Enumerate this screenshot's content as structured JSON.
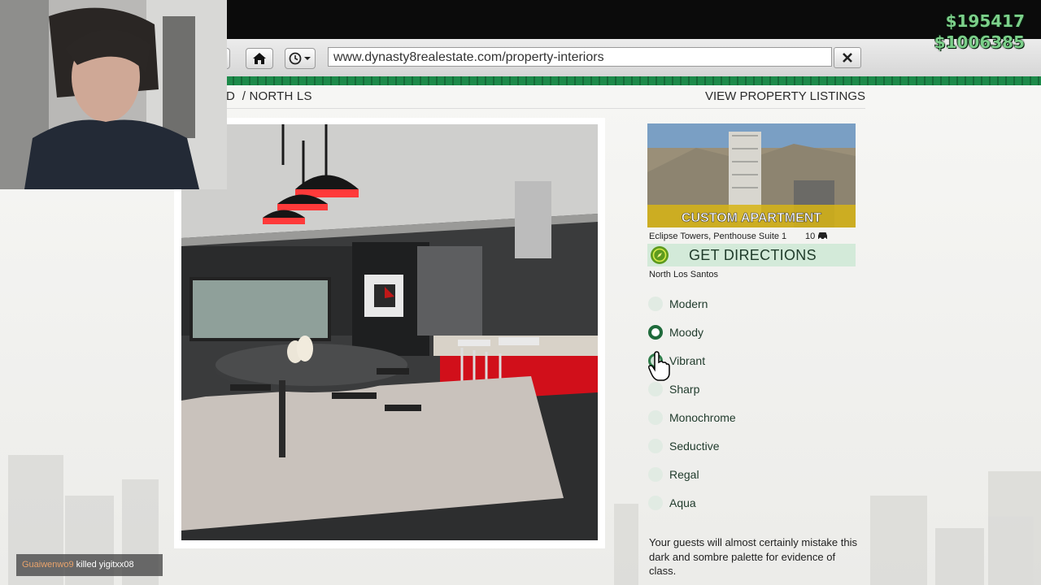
{
  "browser": {
    "url": "www.dynasty8realestate.com/property-interiors",
    "home_icon": "home-icon",
    "history_icon": "history-clock-icon",
    "close_icon": "close-icon"
  },
  "header": {
    "breadcrumb": "D  / NORTH LS",
    "view_listings": "VIEW PROPERTY LISTINGS"
  },
  "property": {
    "banner": "CUSTOM APARTMENT",
    "name": "Eclipse Towers, Penthouse Suite 1",
    "garage_count": "10",
    "garage_icon": "car-icon",
    "directions_label": "GET DIRECTIONS",
    "directions_icon": "compass-icon",
    "area": "North Los Santos"
  },
  "styles": {
    "options": [
      {
        "label": "Modern",
        "selected": false
      },
      {
        "label": "Moody",
        "selected": true
      },
      {
        "label": "Vibrant",
        "selected": false
      },
      {
        "label": "Sharp",
        "selected": false
      },
      {
        "label": "Monochrome",
        "selected": false
      },
      {
        "label": "Seductive",
        "selected": false
      },
      {
        "label": "Regal",
        "selected": false
      },
      {
        "label": "Aqua",
        "selected": false
      }
    ],
    "description": "Your guests will almost certainly mistake this dark and sombre palette for evidence of class."
  },
  "hud": {
    "cash": "$195417",
    "bank": "$1006385"
  },
  "kill_feed": {
    "killer": "Guaiwenwo9",
    "action": "killed",
    "victim": "yigitxx08"
  },
  "colors": {
    "accent_green": "#1e6a3b",
    "stripe_green": "#1d8a4a",
    "money_green": "#7cd08a"
  }
}
